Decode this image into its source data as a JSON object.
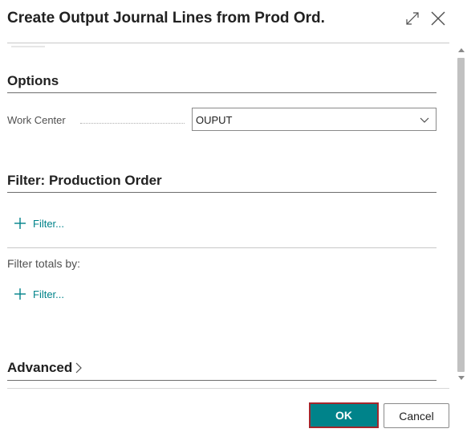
{
  "dialog": {
    "title": "Create Output Journal Lines from Prod Ord."
  },
  "options": {
    "title": "Options",
    "work_center_label": "Work Center",
    "work_center_value": "OUPUT"
  },
  "filter_production_order": {
    "title": "Filter: Production Order",
    "add_filter_label": "Filter...",
    "totals_label": "Filter totals by:",
    "add_totals_filter_label": "Filter..."
  },
  "advanced": {
    "label": "Advanced"
  },
  "footer": {
    "ok_label": "OK",
    "cancel_label": "Cancel"
  },
  "icons": {
    "expand": "expand-icon",
    "close": "close-icon",
    "chevron": "chevron-down-icon",
    "plus": "plus-icon",
    "advanced_chevron": "chevron-right-icon"
  },
  "colors": {
    "accent": "#00838a",
    "focus_border": "#a4262c",
    "text": "#212121"
  }
}
